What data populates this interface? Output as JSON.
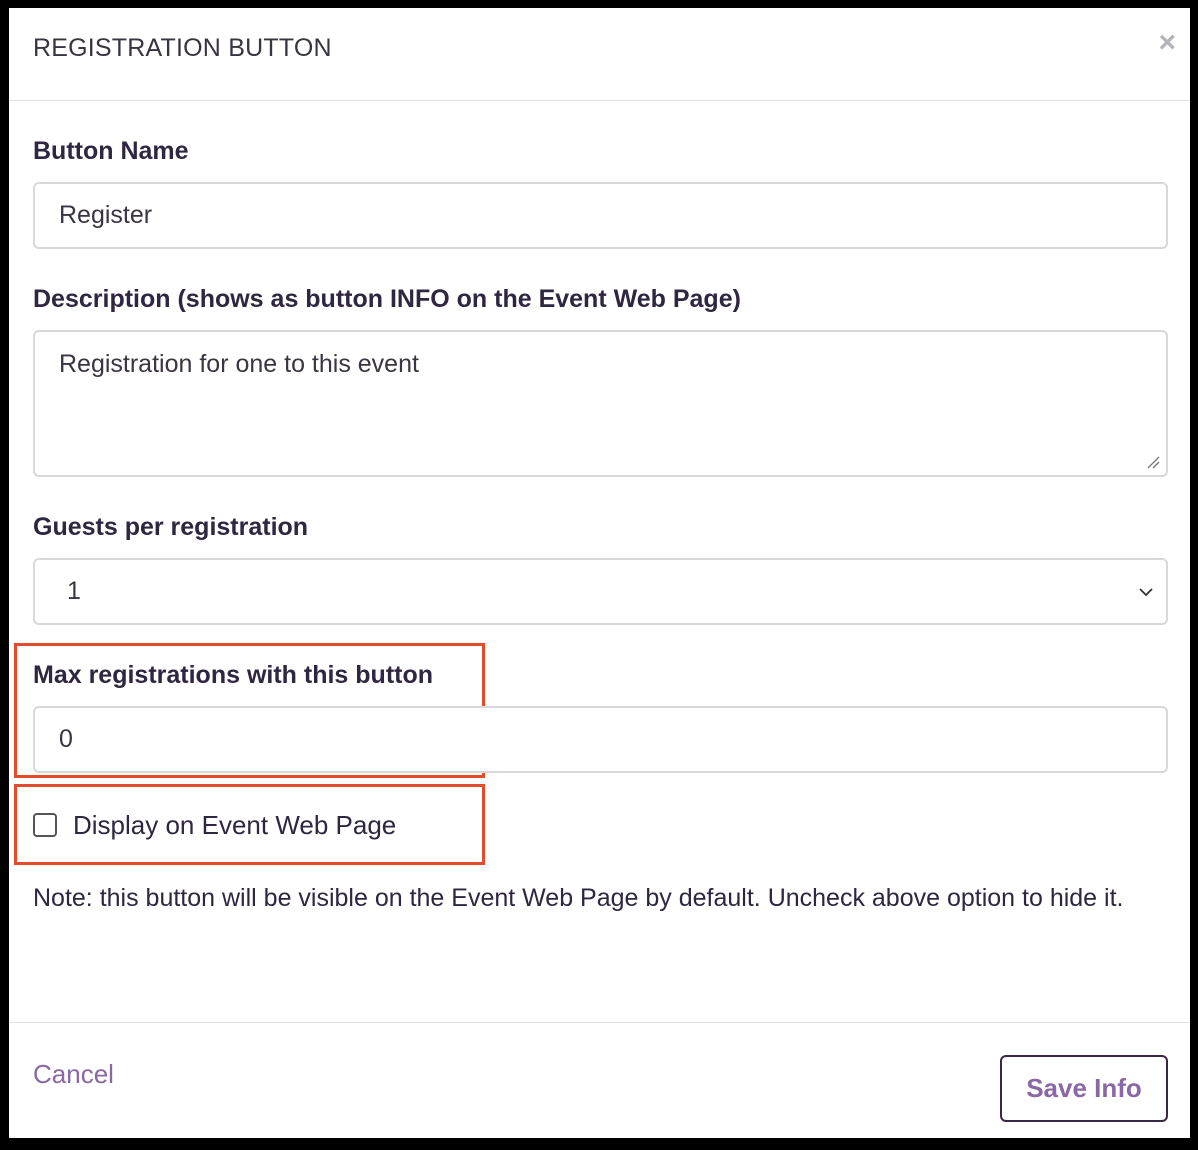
{
  "dialog": {
    "title": "REGISTRATION BUTTON",
    "close_symbol": "×"
  },
  "form": {
    "button_name": {
      "label": "Button Name",
      "value": "Register"
    },
    "description": {
      "label": "Description (shows as button INFO on the Event Web Page)",
      "value": "Registration for one to this event"
    },
    "guests": {
      "label": "Guests per registration",
      "selected": "1"
    },
    "max_registrations": {
      "label": "Max registrations with this button",
      "value": "0"
    },
    "display_on_page": {
      "label": "Display on Event Web Page",
      "checked": false
    },
    "note": "Note: this button will be visible on the Event Web Page by default. Uncheck above option to hide it."
  },
  "footer": {
    "cancel_label": "Cancel",
    "save_label": "Save Info"
  },
  "colors": {
    "highlight": "#e24b2b",
    "accent": "#8a67a5",
    "text": "#2f2640"
  },
  "icons": {
    "close": "close-icon",
    "select_chevron": "chevron-down-icon",
    "resize": "resize-grip-icon"
  }
}
